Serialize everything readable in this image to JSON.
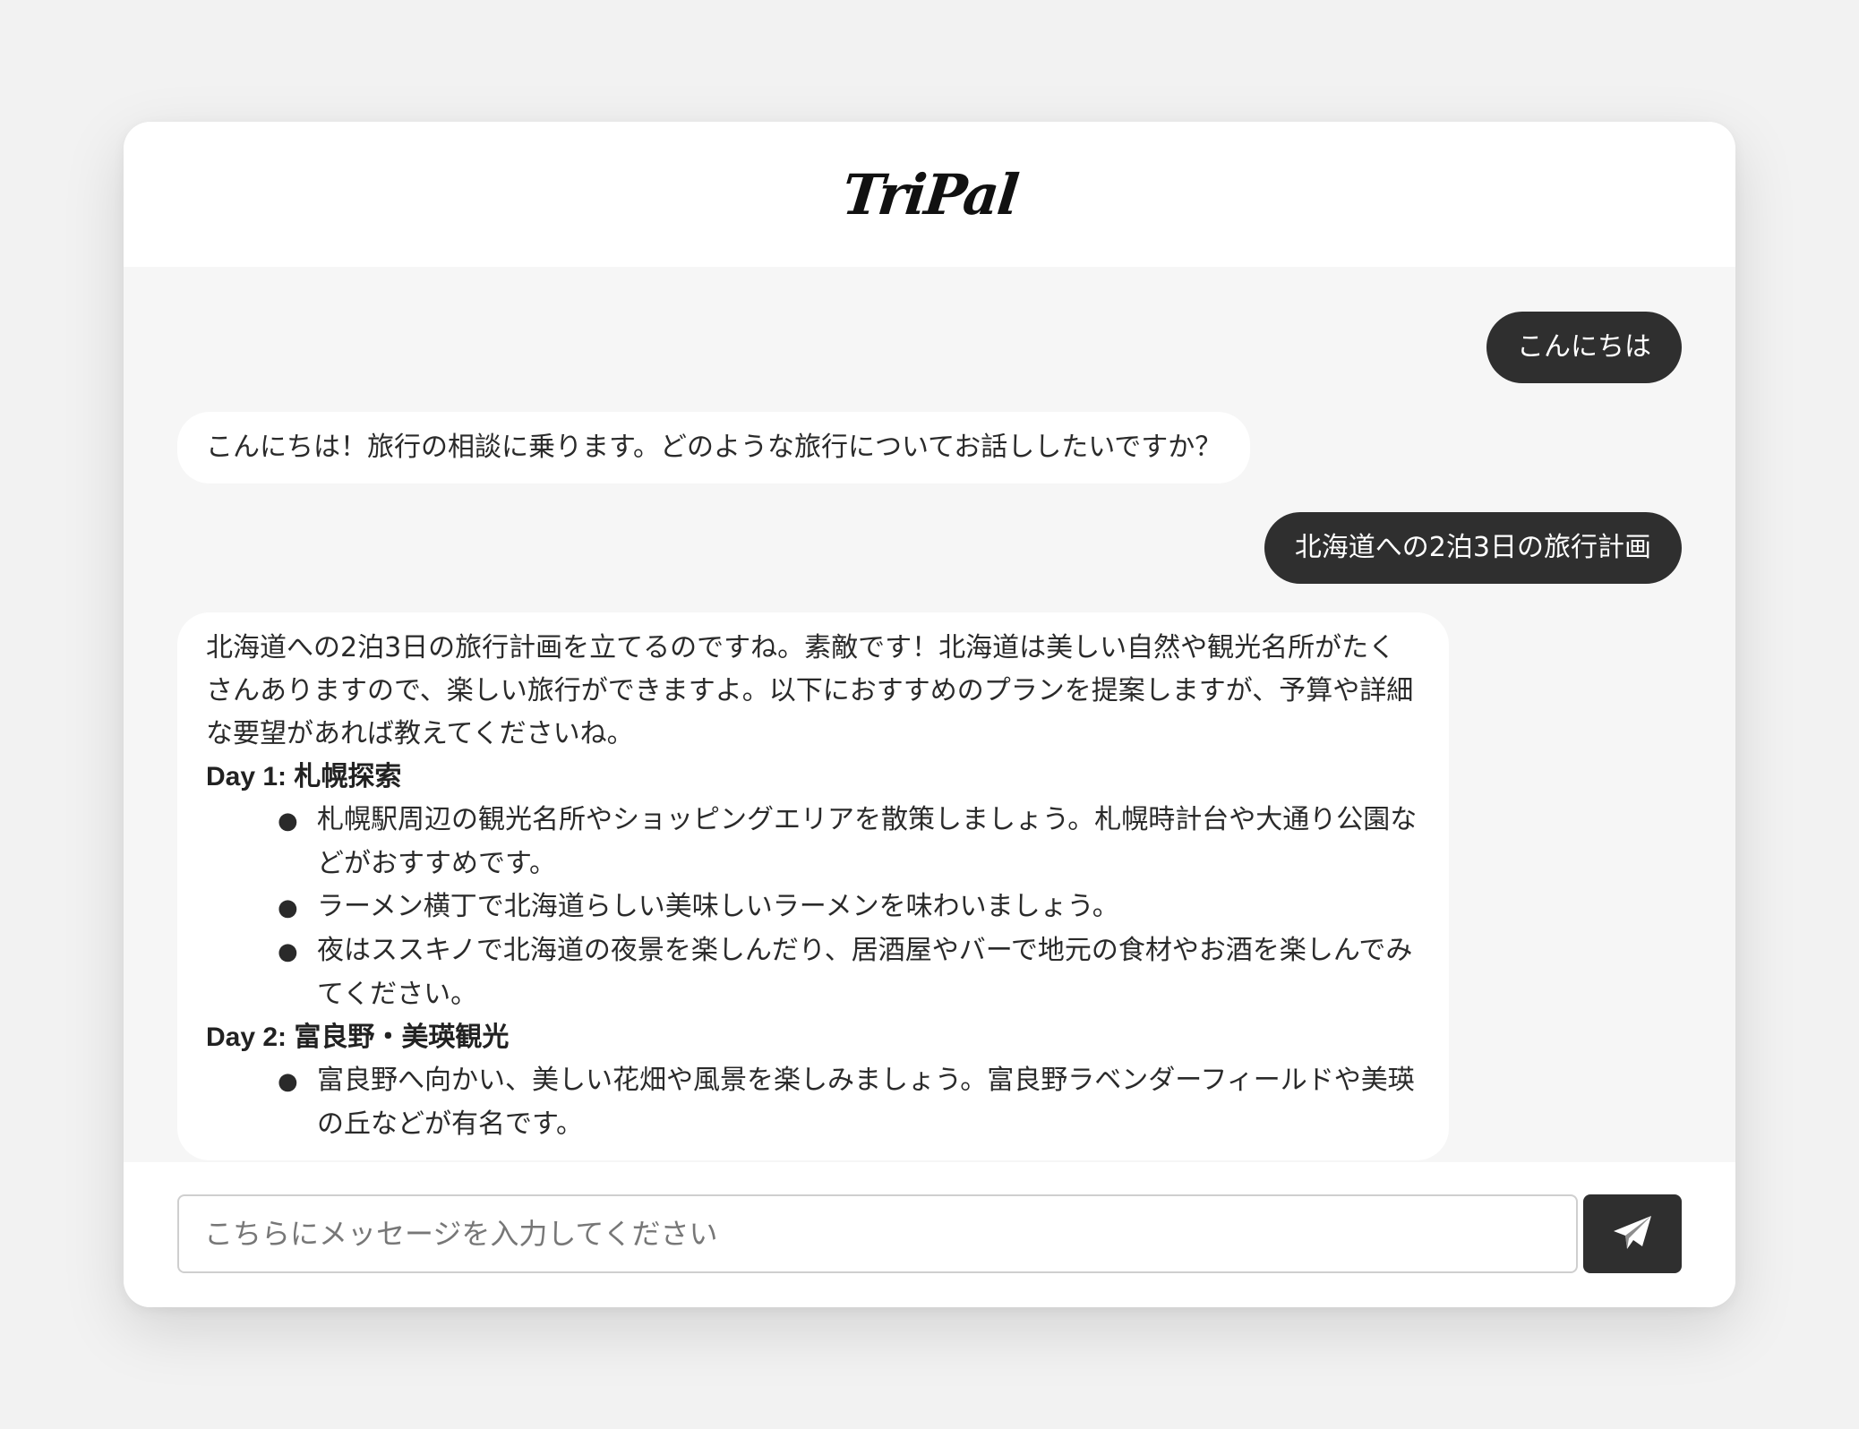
{
  "app": {
    "title": "TriPal"
  },
  "messages": {
    "user_1": "こんにちは",
    "bot_1": "こんにちは！旅行の相談に乗ります。どのような旅行についてお話ししたいですか？",
    "user_2": "北海道への2泊3日の旅行計画",
    "bot_2": {
      "intro": "北海道への2泊3日の旅行計画を立てるのですね。素敵です！北海道は美しい自然や観光名所がたくさんありますので、楽しい旅行ができますよ。以下におすすめのプランを提案しますが、予算や詳細な要望があれば教えてくださいね。",
      "day1_heading": "Day 1: 札幌探索",
      "day1_items": [
        "札幌駅周辺の観光名所やショッピングエリアを散策しましょう。札幌時計台や大通り公園などがおすすめです。",
        "ラーメン横丁で北海道らしい美味しいラーメンを味わいましょう。",
        "夜はススキノで北海道の夜景を楽しんだり、居酒屋やバーで地元の食材やお酒を楽しんでみてください。"
      ],
      "day2_heading": "Day 2: 富良野・美瑛観光",
      "day2_items": [
        "富良野へ向かい、美しい花畑や風景を楽しみましょう。富良野ラベンダーフィールドや美瑛の丘などが有名です。"
      ]
    }
  },
  "composer": {
    "placeholder": "こちらにメッセージを入力してください",
    "value": ""
  },
  "icons": {
    "send": "paper-plane-icon"
  },
  "colors": {
    "user_bubble": "#2f2f2f",
    "bot_bubble": "#ffffff",
    "chat_background": "#f6f6f6",
    "send_button": "#2f2f2f"
  }
}
